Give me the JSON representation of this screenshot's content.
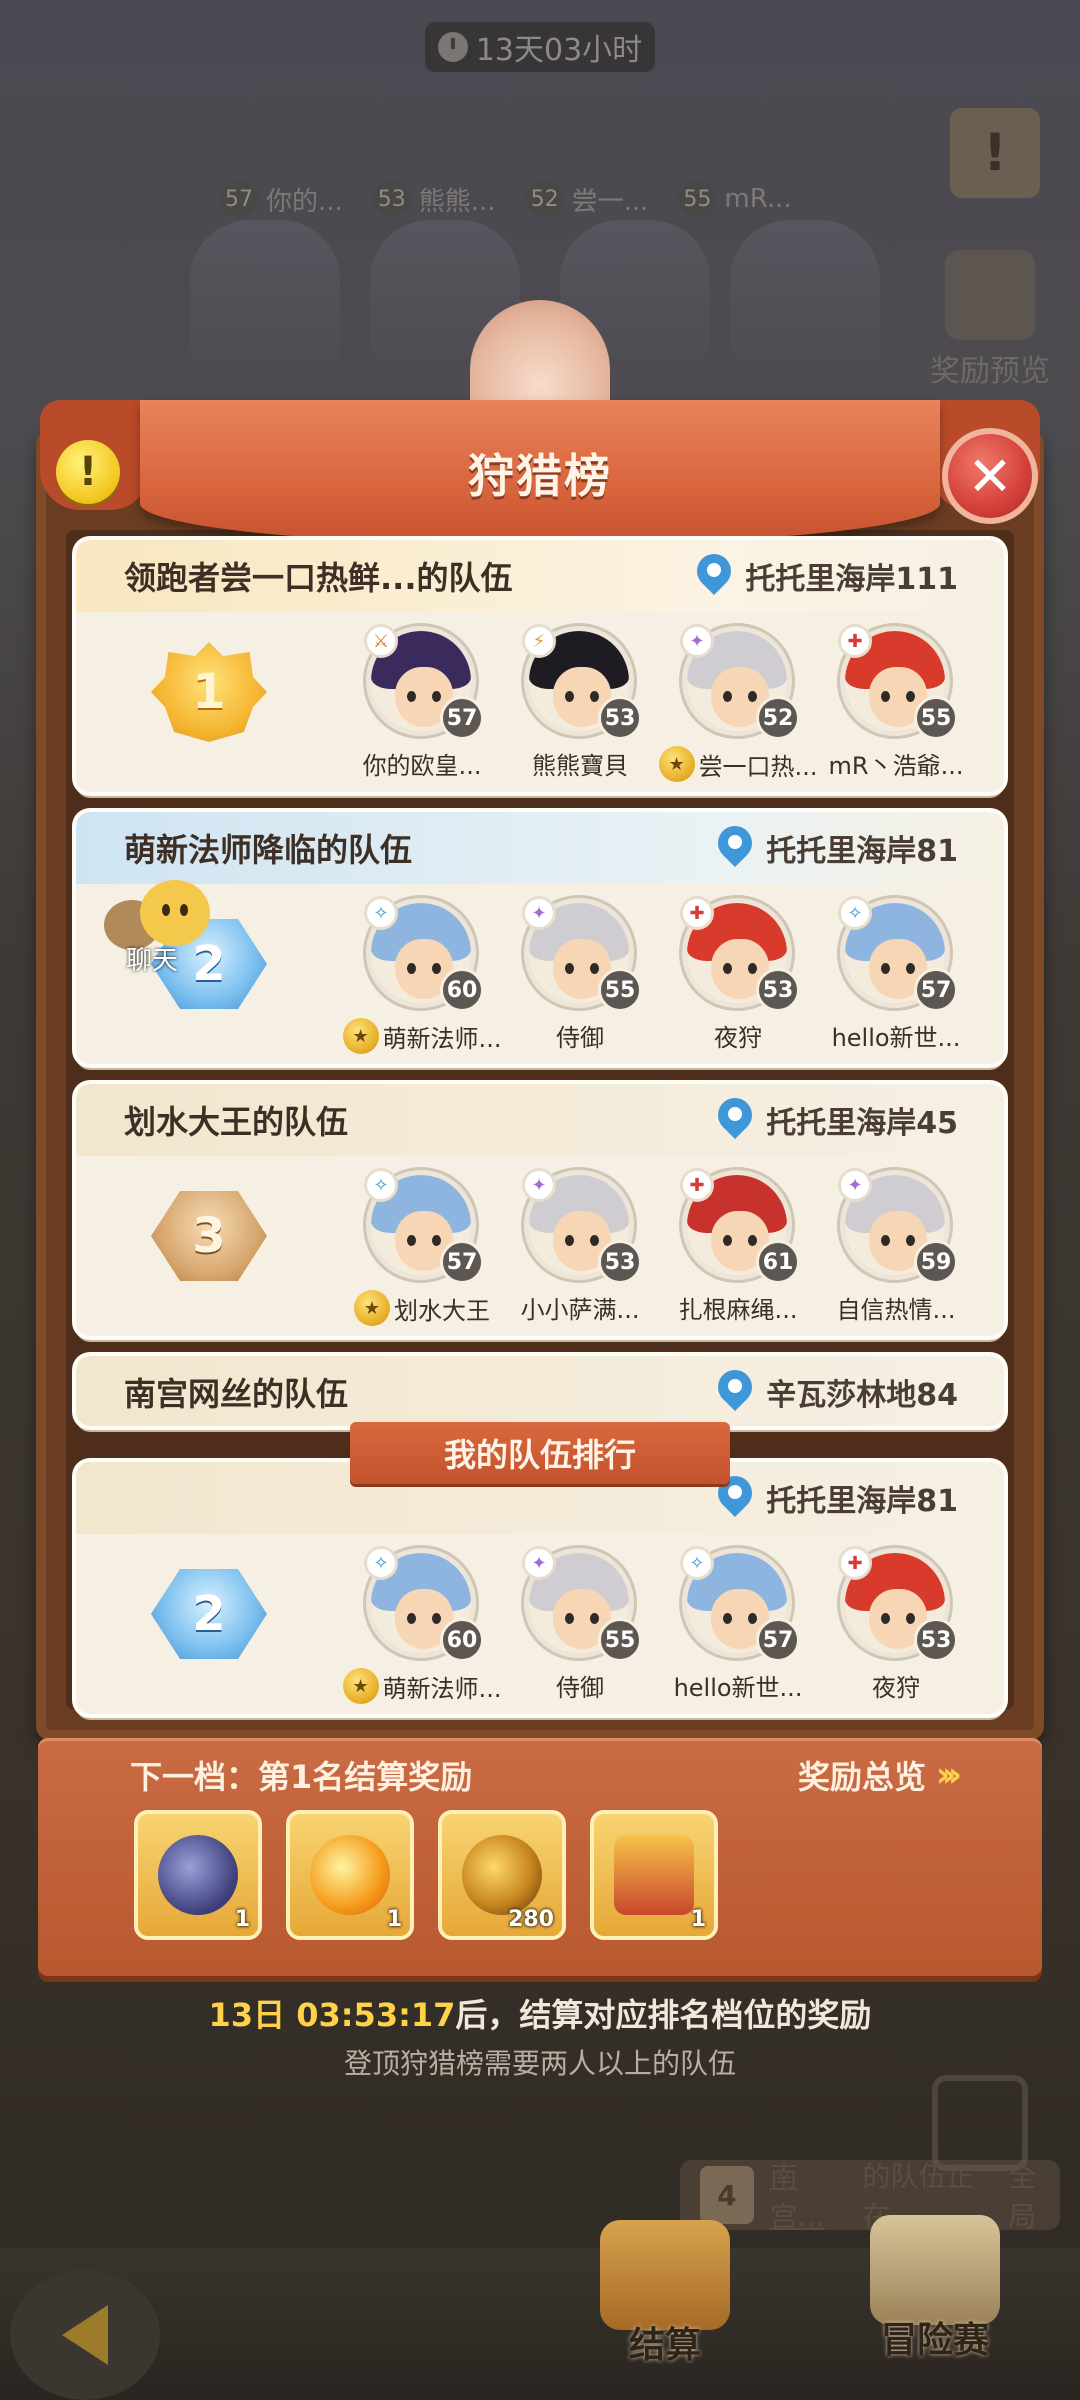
{
  "top_timer": "13天03小时",
  "bg_players": [
    {
      "level": "57",
      "name": "你的..."
    },
    {
      "level": "53",
      "name": "熊熊..."
    },
    {
      "level": "52",
      "name": "尝一..."
    },
    {
      "level": "55",
      "name": "mR..."
    }
  ],
  "side": {
    "reward_preview_label": "奖励预览",
    "scroll_icon": "!"
  },
  "dialog": {
    "title": "狩猎榜",
    "info_icon": "!",
    "close_icon": "✕"
  },
  "teams": [
    {
      "rank": "1",
      "name": "领跑者尝一口热鲜...的队伍",
      "location": "托托里海岸111",
      "members": [
        {
          "name": "你的欧皇...",
          "level": "57",
          "leader": false,
          "class_color": "#e07a2c"
        },
        {
          "name": "熊熊寶貝",
          "level": "53",
          "leader": false,
          "class_color": "#e0a02c"
        },
        {
          "name": "尝一口热...",
          "level": "52",
          "leader": true,
          "class_color": "#a46cd6"
        },
        {
          "name": "mR丶浩爺...",
          "level": "55",
          "leader": false,
          "class_color": "#d63a3a"
        }
      ]
    },
    {
      "rank": "2",
      "name": "萌新法师降临的队伍",
      "location": "托托里海岸81",
      "members": [
        {
          "name": "萌新法师...",
          "level": "60",
          "leader": true,
          "class_color": "#3a9ad6"
        },
        {
          "name": "侍御",
          "level": "55",
          "leader": false,
          "class_color": "#a46cd6"
        },
        {
          "name": "夜狩",
          "level": "53",
          "leader": false,
          "class_color": "#d63a3a"
        },
        {
          "name": "hello新世...",
          "level": "57",
          "leader": false,
          "class_color": "#3a9ad6"
        }
      ]
    },
    {
      "rank": "3",
      "name": "划水大王的队伍",
      "location": "托托里海岸45",
      "members": [
        {
          "name": "划水大王",
          "level": "57",
          "leader": true,
          "class_color": "#3a9ad6"
        },
        {
          "name": "小小萨满...",
          "level": "53",
          "leader": false,
          "class_color": "#a46cd6"
        },
        {
          "name": "扎根麻绳...",
          "level": "61",
          "leader": false,
          "class_color": "#d63a3a"
        },
        {
          "name": "自信热情...",
          "level": "59",
          "leader": false,
          "class_color": "#a46cd6"
        }
      ]
    },
    {
      "rank": "4",
      "name": "南宫网丝的队伍",
      "location": "辛瓦莎林地84"
    }
  ],
  "my_team": {
    "label": "我的队伍排行",
    "rank": "2",
    "location": "托托里海岸81",
    "members": [
      {
        "name": "萌新法师...",
        "level": "60",
        "leader": true,
        "class_color": "#3a9ad6"
      },
      {
        "name": "侍御",
        "level": "55",
        "leader": false,
        "class_color": "#a46cd6"
      },
      {
        "name": "hello新世...",
        "level": "57",
        "leader": false,
        "class_color": "#3a9ad6"
      },
      {
        "name": "夜狩",
        "level": "53",
        "leader": false,
        "class_color": "#d63a3a"
      }
    ]
  },
  "chat": {
    "label": "聊天"
  },
  "reward": {
    "title": "下一档：第1名结算奖励",
    "overview": "奖励总览",
    "items": [
      {
        "icon": "storm-cloud-icon",
        "qty": "1"
      },
      {
        "icon": "flame-icon",
        "qty": "1"
      },
      {
        "icon": "gold-orb-icon",
        "qty": "280"
      },
      {
        "icon": "treasure-chest-icon",
        "qty": "1"
      }
    ]
  },
  "countdown": {
    "time": "13日 03:53:17",
    "suffix": "后，结算对应排名档位的奖励"
  },
  "hint": "登顶狩猎榜需要两人以上的队伍",
  "notify": {
    "rank": "4",
    "team": "南宫...",
    "text": "的队伍正在"
  },
  "overall_label": "全局",
  "tabs": {
    "settle": "结算",
    "adventure": "冒险赛"
  }
}
